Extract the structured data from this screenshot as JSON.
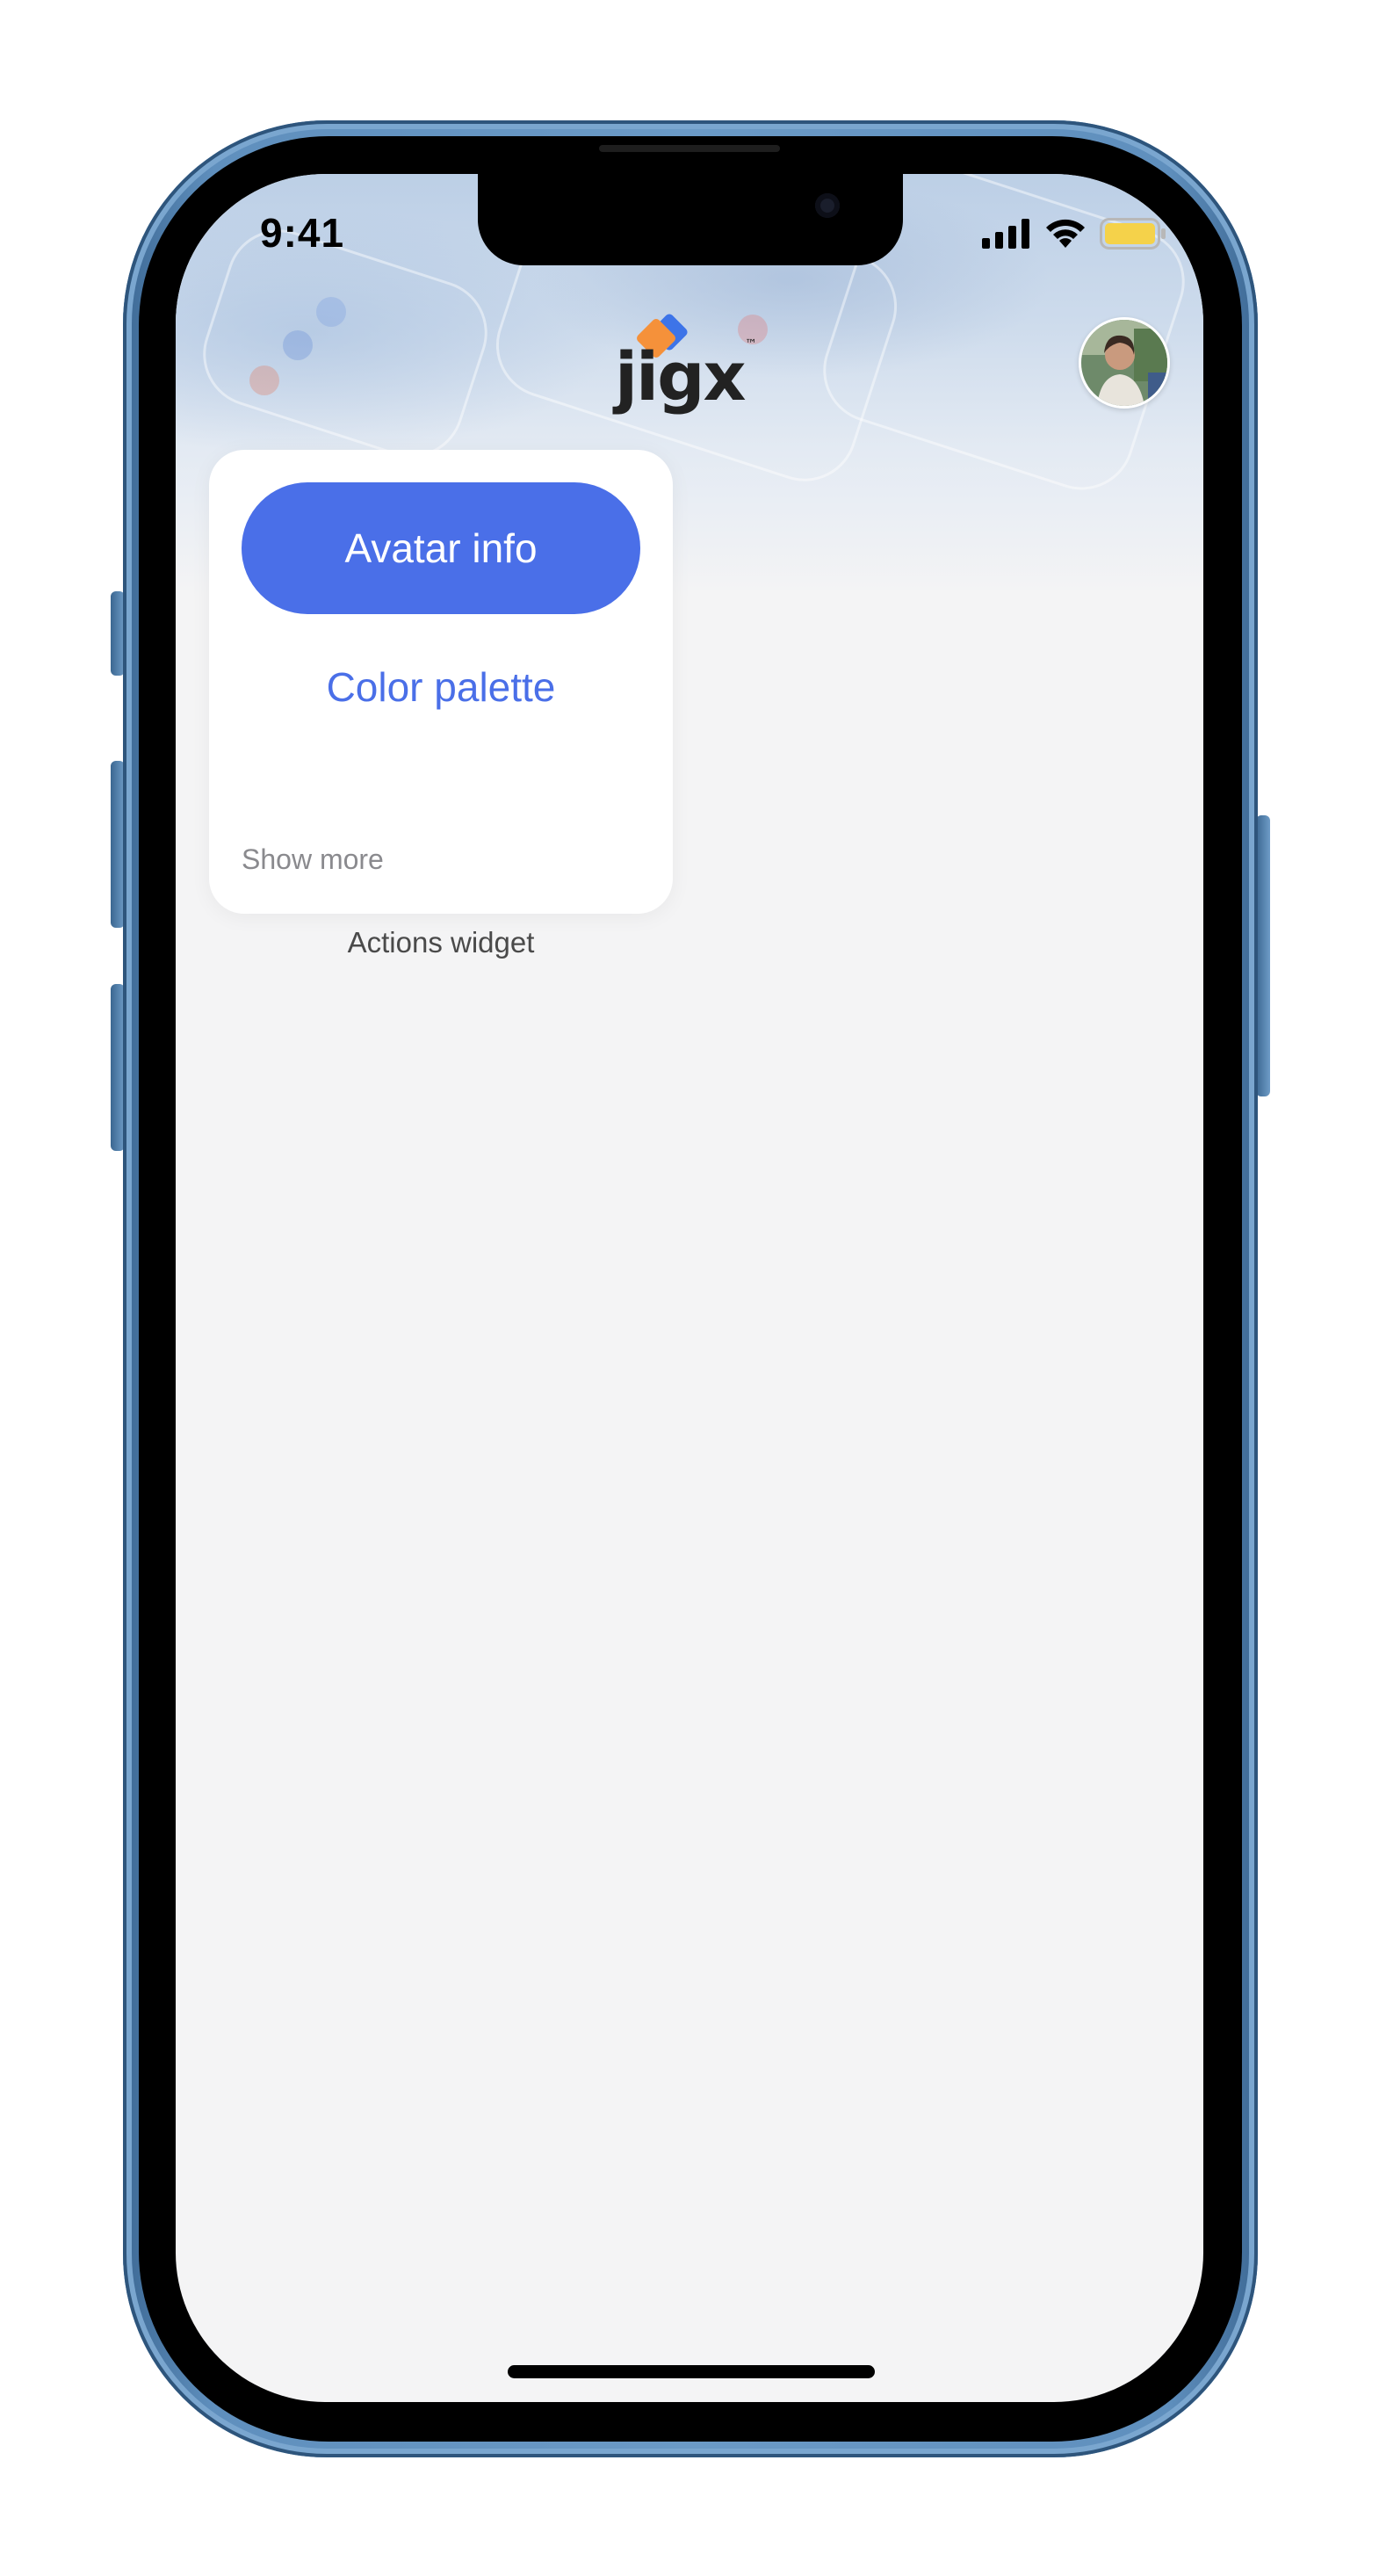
{
  "status_bar": {
    "time": "9:41",
    "icons": [
      "signal-icon",
      "wifi-icon",
      "battery-icon"
    ]
  },
  "header": {
    "logo_text": "jigx",
    "logo_mark": "™",
    "avatar": "user-avatar"
  },
  "actions_widget": {
    "primary_button": "Avatar info",
    "secondary_button": "Color palette",
    "show_more": "Show more",
    "caption": "Actions widget"
  },
  "colors": {
    "accent": "#4a6fe8",
    "screen_background": "#f4f4f5",
    "card_background": "#ffffff",
    "logo_orange": "#f5913a",
    "logo_blue": "#3d74e8",
    "battery": "#f5d24a",
    "phone_frame": "#5f8fbd"
  }
}
